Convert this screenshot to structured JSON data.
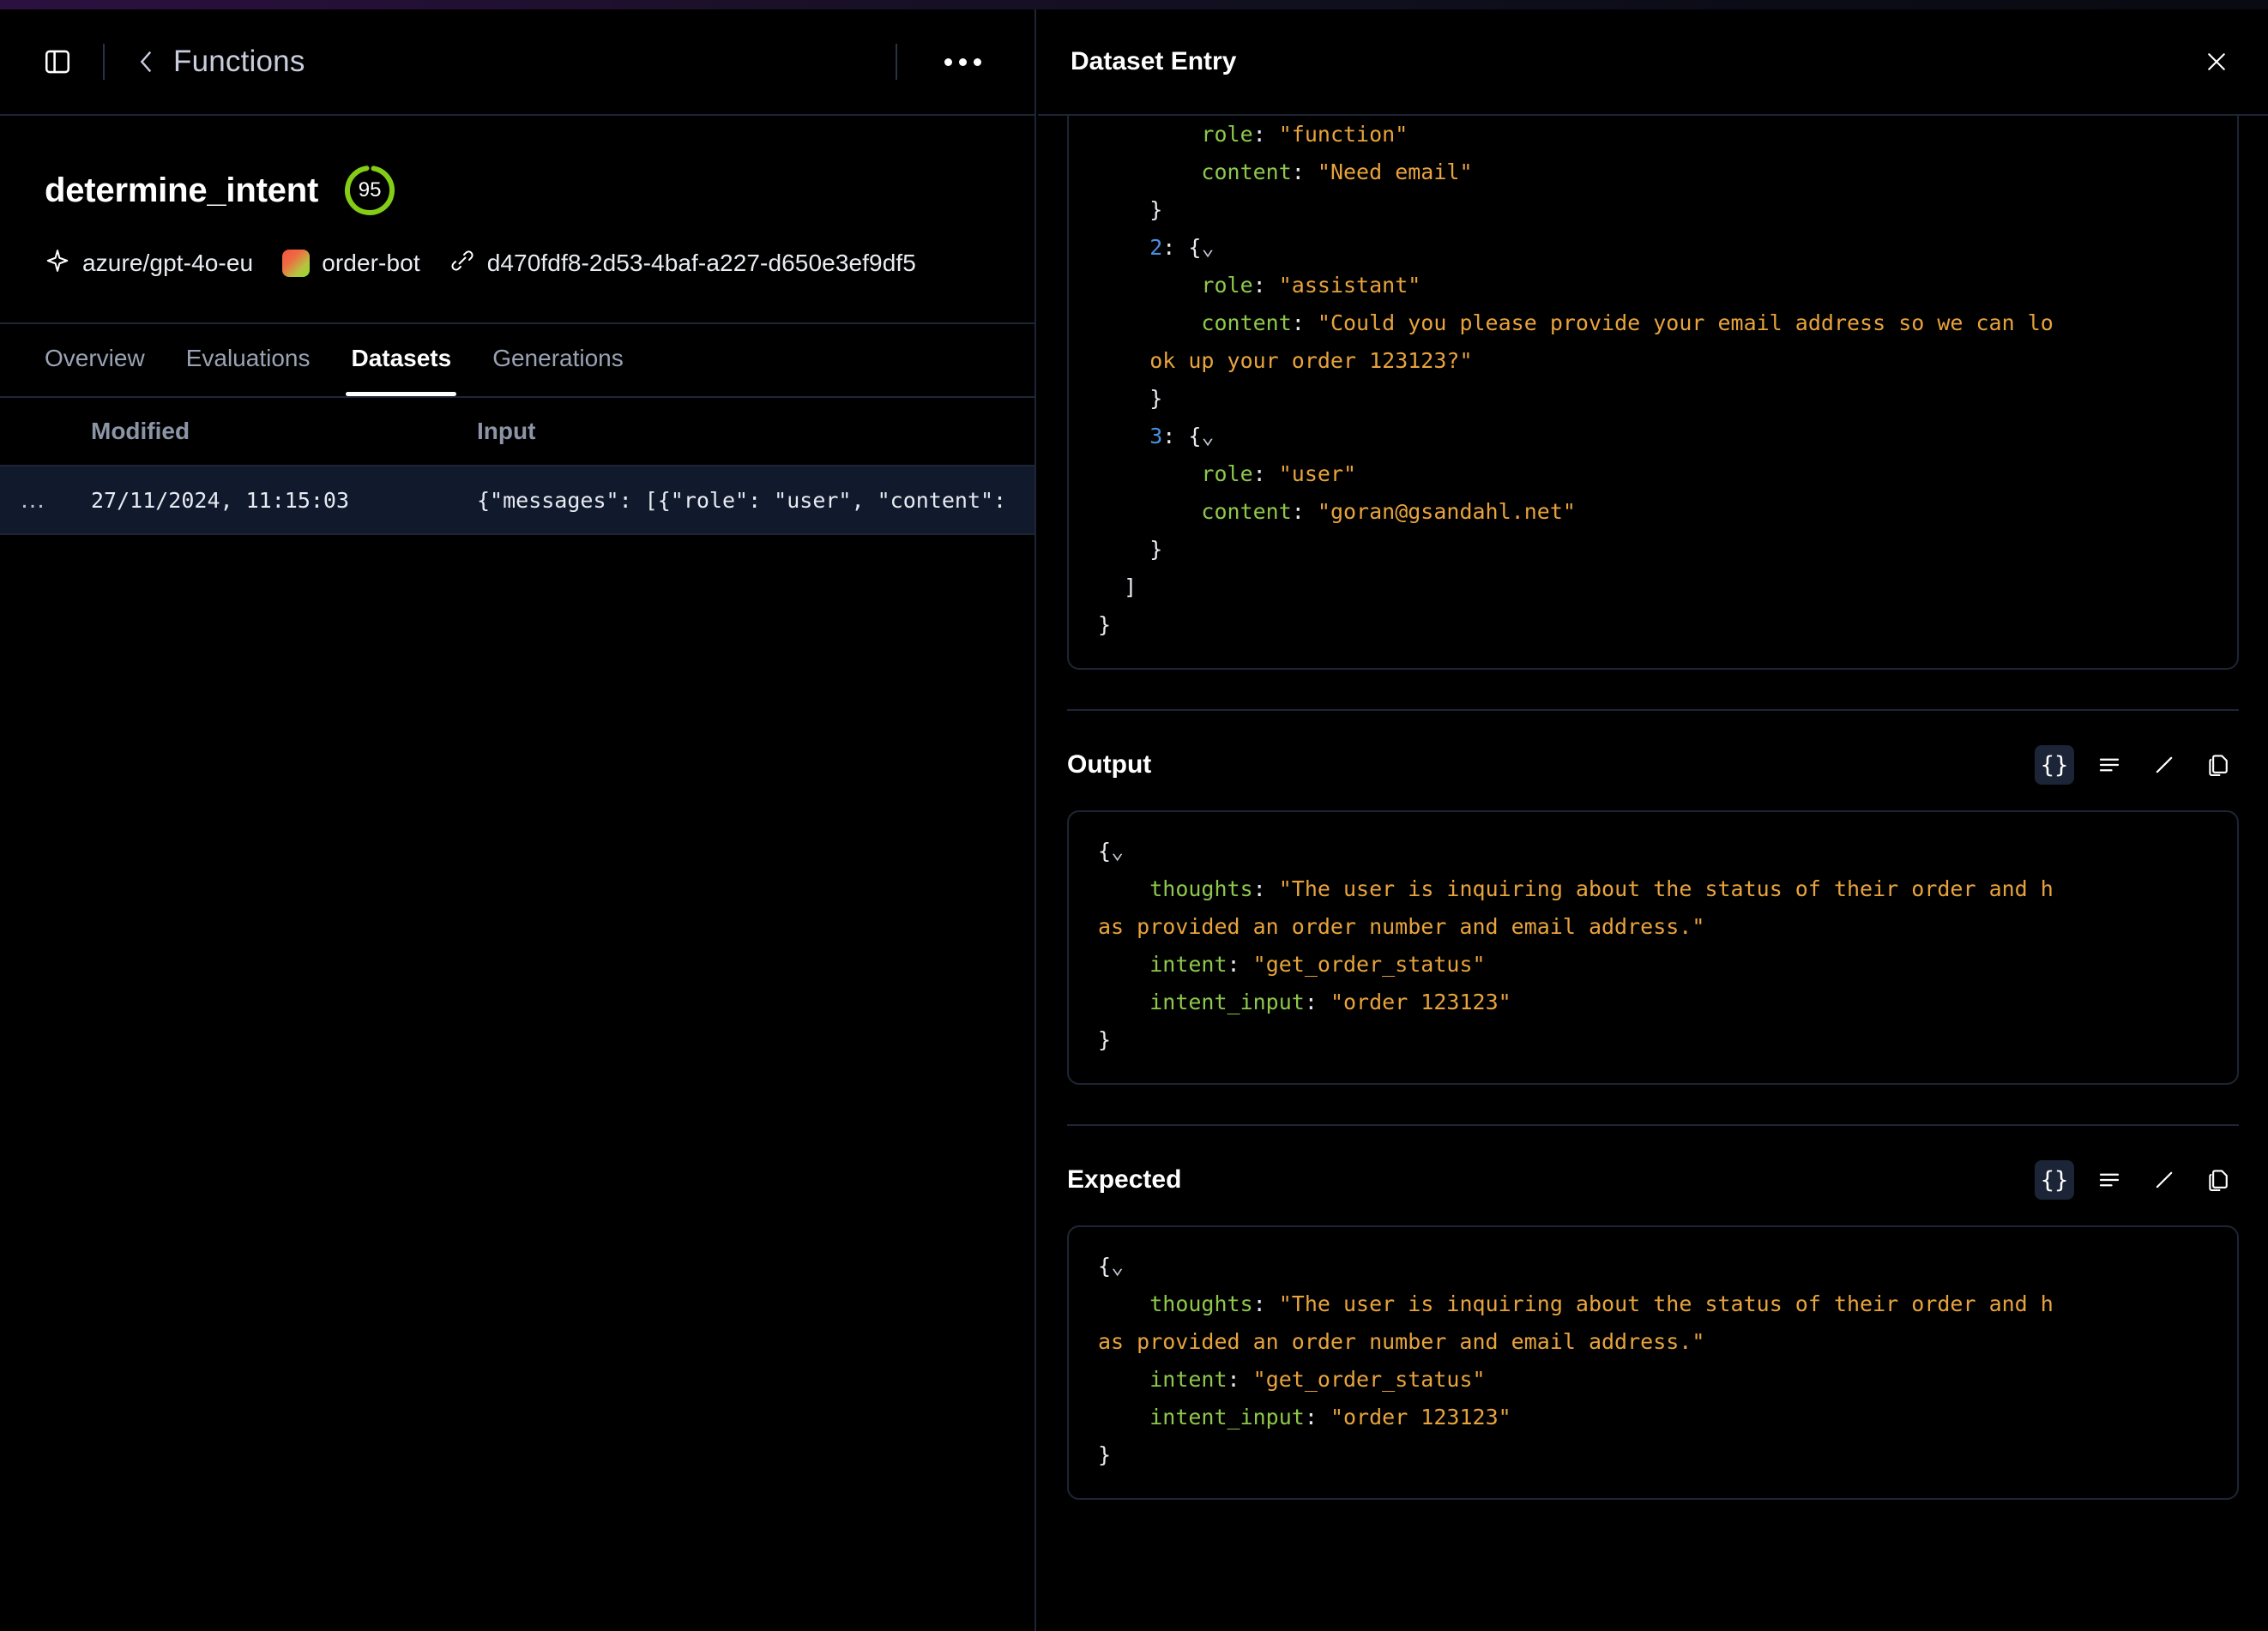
{
  "topbar": {
    "sidebar_toggle_icon": "sidebar-panel-icon",
    "back_icon": "chevron-left-icon",
    "breadcrumb": "Functions",
    "overflow_icon": "ellipsis-icon"
  },
  "function_header": {
    "name": "determine_intent",
    "score": "95",
    "score_color": "#84cc16",
    "meta": [
      {
        "icon": "sparkle-icon",
        "label": "azure/gpt-4o-eu"
      },
      {
        "icon": "bot-avatar-icon",
        "label": "order-bot"
      },
      {
        "icon": "link-icon",
        "label": "d470fdf8-2d53-4baf-a227-d650e3ef9df5"
      }
    ]
  },
  "tabs": [
    {
      "label": "Overview",
      "active": false
    },
    {
      "label": "Evaluations",
      "active": false
    },
    {
      "label": "Datasets",
      "active": true
    },
    {
      "label": "Generations",
      "active": false
    }
  ],
  "table": {
    "columns": [
      "Modified",
      "Input"
    ],
    "rows": [
      {
        "actions": "…",
        "modified": "27/11/2024, 11:15:03",
        "input": "{\"messages\": [{\"role\": \"user\", \"content\":"
      }
    ]
  },
  "panel": {
    "title": "Dataset Entry",
    "close_icon": "close-icon"
  },
  "input_section": {
    "lines": [
      {
        "indent": 2,
        "parts": [
          {
            "t": "k",
            "v": "role"
          },
          {
            "t": "p",
            "v": ": "
          },
          {
            "t": "s",
            "v": "\"function\""
          }
        ]
      },
      {
        "indent": 2,
        "parts": [
          {
            "t": "k",
            "v": "content"
          },
          {
            "t": "p",
            "v": ": "
          },
          {
            "t": "s",
            "v": "\"Need email\""
          }
        ]
      },
      {
        "indent": 1,
        "parts": [
          {
            "t": "p",
            "v": "}"
          }
        ]
      },
      {
        "indent": 1,
        "parts": [
          {
            "t": "n",
            "v": "2"
          },
          {
            "t": "p",
            "v": ": {"
          },
          {
            "t": "caret",
            "v": "⌄"
          }
        ]
      },
      {
        "indent": 2,
        "parts": [
          {
            "t": "k",
            "v": "role"
          },
          {
            "t": "p",
            "v": ": "
          },
          {
            "t": "s",
            "v": "\"assistant\""
          }
        ]
      },
      {
        "indent": 2,
        "parts": [
          {
            "t": "k",
            "v": "content"
          },
          {
            "t": "p",
            "v": ": "
          },
          {
            "t": "s",
            "v": "\"Could you please provide your email address so we can lo"
          }
        ]
      },
      {
        "indent": 1,
        "parts": [
          {
            "t": "s",
            "v": "ok up your order 123123?\""
          }
        ]
      },
      {
        "indent": 1,
        "parts": [
          {
            "t": "p",
            "v": "}"
          }
        ]
      },
      {
        "indent": 1,
        "parts": [
          {
            "t": "n",
            "v": "3"
          },
          {
            "t": "p",
            "v": ": {"
          },
          {
            "t": "caret",
            "v": "⌄"
          }
        ]
      },
      {
        "indent": 2,
        "parts": [
          {
            "t": "k",
            "v": "role"
          },
          {
            "t": "p",
            "v": ": "
          },
          {
            "t": "s",
            "v": "\"user\""
          }
        ]
      },
      {
        "indent": 2,
        "parts": [
          {
            "t": "k",
            "v": "content"
          },
          {
            "t": "p",
            "v": ": "
          },
          {
            "t": "s",
            "v": "\"goran@gsandahl.net\""
          }
        ]
      },
      {
        "indent": 1,
        "parts": [
          {
            "t": "p",
            "v": "}"
          }
        ]
      },
      {
        "indent": 0.5,
        "parts": [
          {
            "t": "p",
            "v": "]"
          }
        ]
      },
      {
        "indent": 0,
        "parts": [
          {
            "t": "p",
            "v": "}"
          }
        ]
      }
    ]
  },
  "output_section": {
    "title": "Output",
    "tools": [
      {
        "icon": "json-view-icon",
        "label": "{}",
        "active": true
      },
      {
        "icon": "text-view-icon",
        "label": "",
        "active": false
      },
      {
        "icon": "edit-pencil-icon",
        "label": "",
        "active": false
      },
      {
        "icon": "copy-icon",
        "label": "",
        "active": false
      }
    ],
    "lines": [
      {
        "indent": 0,
        "parts": [
          {
            "t": "p",
            "v": "{"
          },
          {
            "t": "caret",
            "v": "⌄"
          }
        ]
      },
      {
        "indent": 1,
        "parts": [
          {
            "t": "k",
            "v": "thoughts"
          },
          {
            "t": "p",
            "v": ": "
          },
          {
            "t": "s",
            "v": "\"The user is inquiring about the status of their order and h"
          }
        ]
      },
      {
        "indent": 0,
        "parts": [
          {
            "t": "s",
            "v": "as provided an order number and email address.\""
          }
        ]
      },
      {
        "indent": 1,
        "parts": [
          {
            "t": "k",
            "v": "intent"
          },
          {
            "t": "p",
            "v": ": "
          },
          {
            "t": "s",
            "v": "\"get_order_status\""
          }
        ]
      },
      {
        "indent": 1,
        "parts": [
          {
            "t": "k",
            "v": "intent_input"
          },
          {
            "t": "p",
            "v": ": "
          },
          {
            "t": "s",
            "v": "\"order 123123\""
          }
        ]
      },
      {
        "indent": 0,
        "parts": [
          {
            "t": "p",
            "v": "}"
          }
        ]
      }
    ]
  },
  "expected_section": {
    "title": "Expected",
    "tools": [
      {
        "icon": "json-view-icon",
        "label": "{}",
        "active": true
      },
      {
        "icon": "text-view-icon",
        "label": "",
        "active": false
      },
      {
        "icon": "edit-pencil-icon",
        "label": "",
        "active": false
      },
      {
        "icon": "copy-icon",
        "label": "",
        "active": false
      }
    ],
    "lines": [
      {
        "indent": 0,
        "parts": [
          {
            "t": "p",
            "v": "{"
          },
          {
            "t": "caret",
            "v": "⌄"
          }
        ]
      },
      {
        "indent": 1,
        "parts": [
          {
            "t": "k",
            "v": "thoughts"
          },
          {
            "t": "p",
            "v": ": "
          },
          {
            "t": "s",
            "v": "\"The user is inquiring about the status of their order and h"
          }
        ]
      },
      {
        "indent": 0,
        "parts": [
          {
            "t": "s",
            "v": "as provided an order number and email address.\""
          }
        ]
      },
      {
        "indent": 1,
        "parts": [
          {
            "t": "k",
            "v": "intent"
          },
          {
            "t": "p",
            "v": ": "
          },
          {
            "t": "s",
            "v": "\"get_order_status\""
          }
        ]
      },
      {
        "indent": 1,
        "parts": [
          {
            "t": "k",
            "v": "intent_input"
          },
          {
            "t": "p",
            "v": ": "
          },
          {
            "t": "s",
            "v": "\"order 123123\""
          }
        ]
      },
      {
        "indent": 0,
        "parts": [
          {
            "t": "p",
            "v": "}"
          }
        ]
      }
    ]
  }
}
